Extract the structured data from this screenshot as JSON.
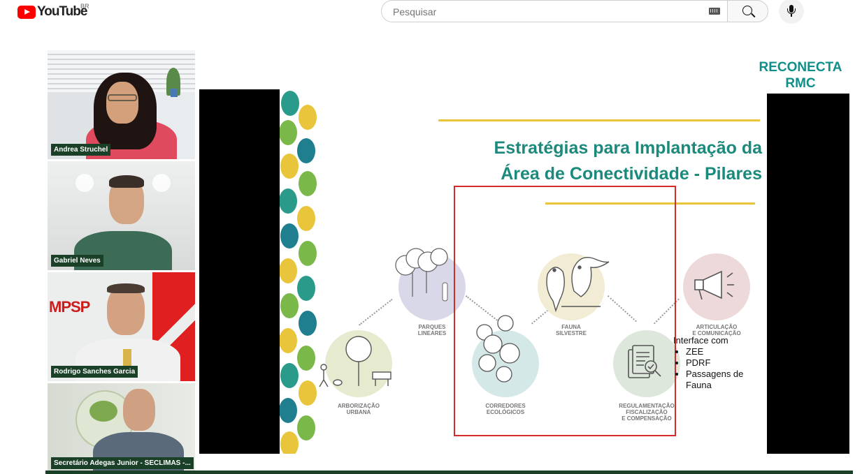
{
  "header": {
    "logo_text": "YouTube",
    "country_code": "BR",
    "search_placeholder": "Pesquisar"
  },
  "participants": [
    {
      "name": "Andrea Struchel"
    },
    {
      "name": "Gabriel Neves"
    },
    {
      "name": "Rodrigo Sanches Garcia"
    },
    {
      "name": "Secretário Adegas Junior - SECLIMAS -..."
    }
  ],
  "slide": {
    "brand_line1": "RECONECTA",
    "brand_line2": "RMC",
    "title_line1": "Estratégias para Implantação da",
    "title_line2": "Área de Conectividade - Pilares",
    "pillars": [
      {
        "label_lines": [
          "PARQUES",
          "LINEARES"
        ]
      },
      {
        "label_lines": [
          "ARBORIZAÇÃO",
          "URBANA"
        ]
      },
      {
        "label_lines": [
          "CORREDORES",
          "ECOLÓGICOS"
        ]
      },
      {
        "label_lines": [
          "FAUNA",
          "SILVESTRE"
        ]
      },
      {
        "label_lines": [
          "REGULAMENTAÇÃO",
          "FISCALIZAÇÃO",
          "E COMPENSAÇÃO"
        ]
      },
      {
        "label_lines": [
          "ARTICULAÇÃO",
          "E COMUNICAÇÃO"
        ]
      }
    ],
    "interface_title": "Interface com",
    "interface_items": [
      "ZEE",
      "PDRF",
      "Passagens de Fauna"
    ],
    "mpsp_logo": "MPSP",
    "colors": {
      "title": "#1b8a7c",
      "accent_gold": "#e8c53a",
      "highlight_red": "#d72a2a",
      "name_tag": "#1a4128"
    }
  }
}
